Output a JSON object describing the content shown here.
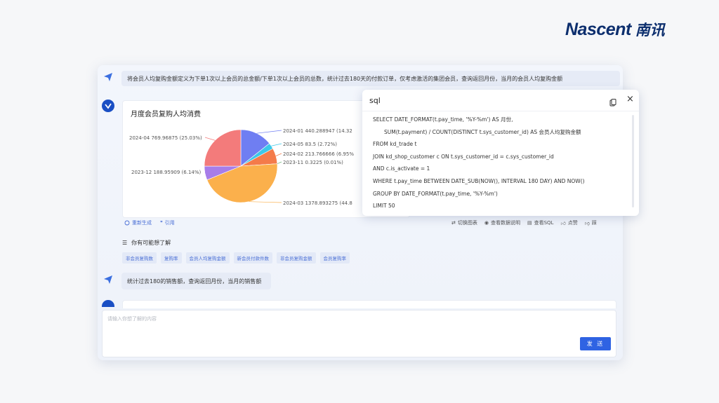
{
  "brand": {
    "name": "Nascent",
    "name_cn": "南讯"
  },
  "messages": {
    "first_question": "将会员人均复购金额定义为下单1次以上会员的总金额/下单1次以上会员的总数，统计过去180天的付款订单，仅考虑激活的集团会员，查询返回月份，当月的会员人均复购金额",
    "second_question": "统计过去180的销售额，查询返回月份，当月的销售额"
  },
  "chart": {
    "title": "月度会员复购人均消费",
    "labels": [
      "2024-01 440.288947 (14.32",
      "2024-05 83.5 (2.72%)",
      "2024-02 213.766666 (6.95%",
      "2023-11 0.3225 (0.01%)",
      "2024-03 1378.893275 (44.8",
      "2023-12 188.95909 (6.14%)",
      "2024-04 769.96875 (25.03%)"
    ]
  },
  "chart_data": {
    "type": "pie",
    "title": "月度会员复购人均消费",
    "categories": [
      "2024-01",
      "2024-05",
      "2024-02",
      "2023-11",
      "2024-03",
      "2023-12",
      "2024-04"
    ],
    "values": [
      440.288947,
      83.5,
      213.766666,
      0.3225,
      1378.893275,
      188.95909,
      769.96875
    ],
    "percentages": [
      14.32,
      2.72,
      6.95,
      0.01,
      44.8,
      6.14,
      25.03
    ],
    "colors": [
      "#6f7ef2",
      "#3cc8e8",
      "#f47b4a",
      "#6fb37a",
      "#fbb04c",
      "#a77de9",
      "#f37b7b"
    ]
  },
  "actions": {
    "regenerate": "重新生成",
    "quote": "引用",
    "switch_chart": "切换图表",
    "view_data_desc": "查看数据说明",
    "view_sql": "查看SQL",
    "like": "点赞",
    "dislike": "踩"
  },
  "suggestions": {
    "title": "你有可能想了解",
    "chips": [
      "非会员复购数",
      "复购率",
      "会员人均复购金额",
      "新会员付款件数",
      "非会员复购金额",
      "会员复购率"
    ]
  },
  "input": {
    "placeholder": "请输入你想了解的内容",
    "send_label": "发 送"
  },
  "sql_panel": {
    "title": "sql",
    "lines": [
      "SELECT DATE_FORMAT(t.pay_time, '%Y-%m') AS 月份,",
      "      SUM(t.payment) / COUNT(DISTINCT t.sys_customer_id) AS 会员人均复购金额",
      "FROM kd_trade t",
      "JOIN kd_shop_customer c ON t.sys_customer_id = c.sys_customer_id",
      "AND c.is_activate = 1",
      "WHERE t.pay_time BETWEEN DATE_SUB(NOW(), INTERVAL 180 DAY) AND NOW()",
      "GROUP BY DATE_FORMAT(t.pay_time, '%Y-%m')",
      "LIMIT 50"
    ]
  }
}
